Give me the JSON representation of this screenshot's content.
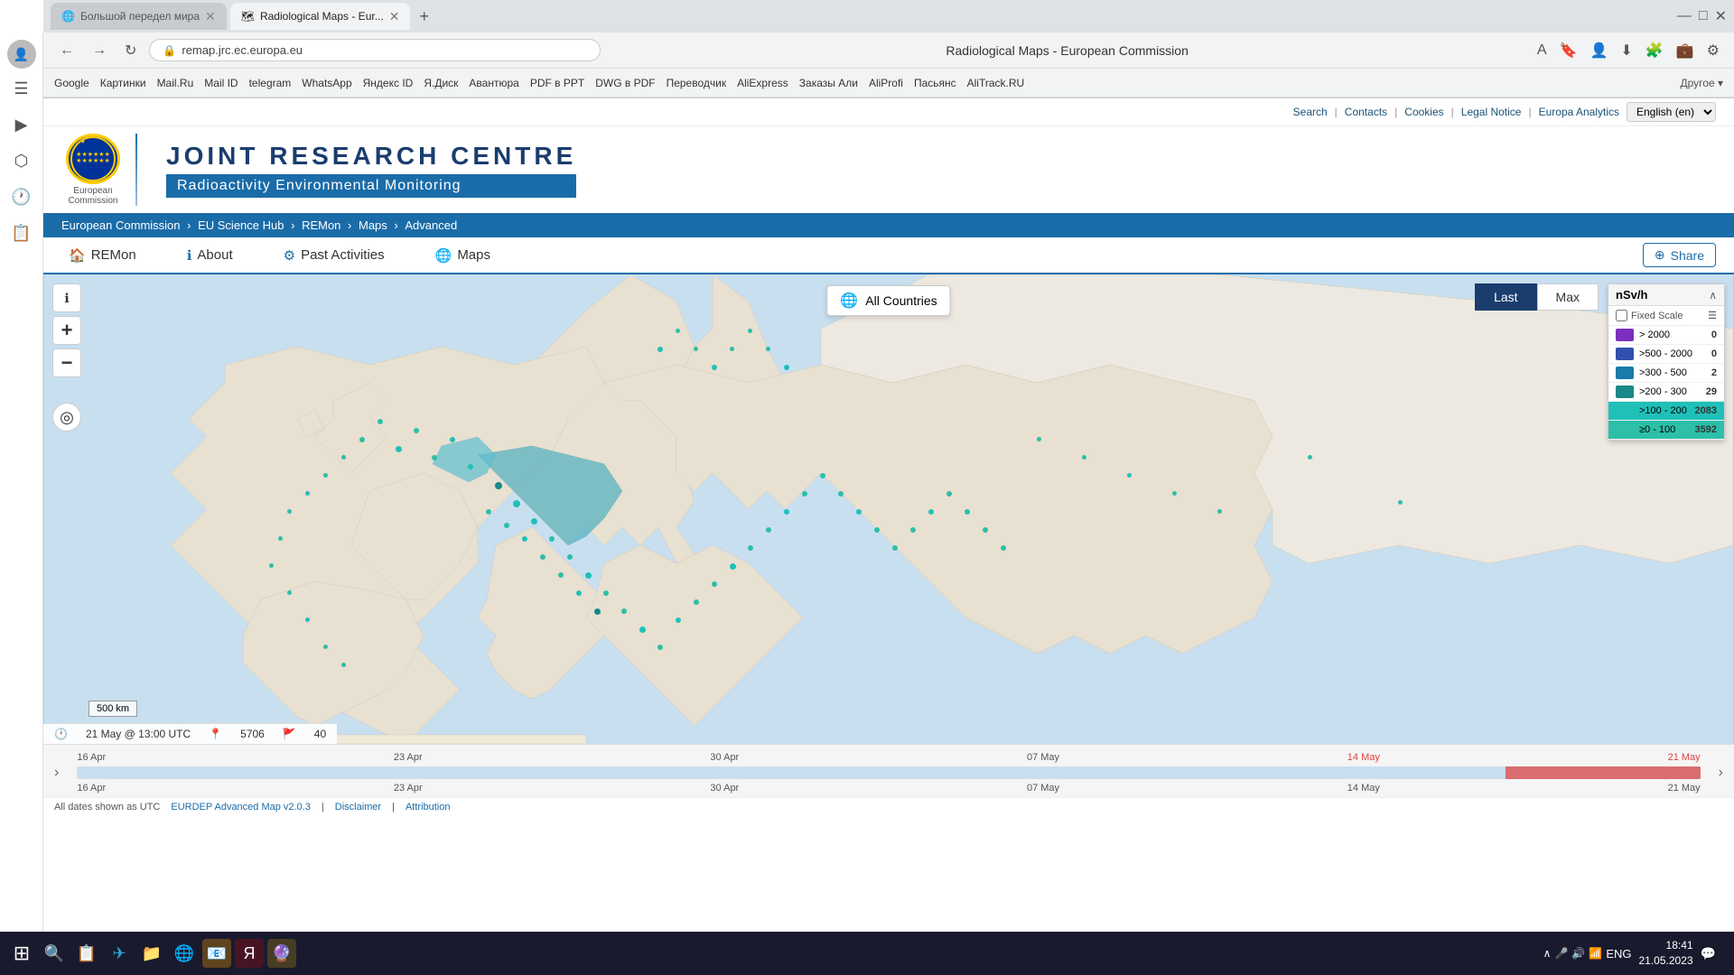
{
  "browser": {
    "tabs": [
      {
        "id": "tab1",
        "title": "Большой передел мира",
        "favicon": "🌐",
        "active": false
      },
      {
        "id": "tab2",
        "title": "Radiological Maps - Eur...",
        "favicon": "🗺",
        "active": true
      }
    ],
    "address": "remap.jrc.ec.europa.eu",
    "page_title": "Radiological Maps - European Commission",
    "bookmarks": [
      "Google",
      "Картинки",
      "Mail.Ru",
      "Mail ID",
      "telegram",
      "WhatsApp",
      "Яндекс ID",
      "Я.Диск",
      "Авантюра",
      "PDF в PPT",
      "DWG в PDF",
      "Переводчик",
      "AliExpress",
      "Заказы Али",
      "AliProfi",
      "Пасьянс",
      "AliTrack.RU"
    ],
    "more_label": "Другое ▾"
  },
  "header_top": {
    "links": [
      "Search",
      "Contacts",
      "Cookies",
      "Legal Notice",
      "Europa Analytics"
    ],
    "lang": "English (en)"
  },
  "site": {
    "jrc_title": "JOINT  RESEARCH  CENTRE",
    "subtitle": "Radioactivity Environmental Monitoring",
    "ec_text1": "European",
    "ec_text2": "Commission"
  },
  "breadcrumb": {
    "items": [
      "European Commission",
      "EU Science Hub",
      "REMon",
      "Maps",
      "Advanced"
    ]
  },
  "nav": {
    "home_label": "REMon",
    "about_label": "About",
    "past_label": "Past Activities",
    "maps_label": "Maps",
    "share_label": "Share"
  },
  "map": {
    "country_selector": "All Countries",
    "scale": "500 km"
  },
  "last_max": {
    "last_label": "Last",
    "max_label": "Max"
  },
  "legend": {
    "unit": "nSv/h",
    "fixed_scale_label": "Fixed Scale",
    "menu_icon": "☰",
    "items": [
      {
        "range": "> 2000",
        "color": "#7b2fbe",
        "count": "0"
      },
      {
        "range": ">500 - 2000",
        "color": "#3050b0",
        "count": "0"
      },
      {
        "range": ">300 - 500",
        "color": "#1a7aaa",
        "count": "2"
      },
      {
        "range": ">200 - 300",
        "color": "#1a8888",
        "count": "29"
      },
      {
        "range": ">100 - 200",
        "color": "#20c0b8",
        "count": "2083"
      },
      {
        "range": "≥0 - 100",
        "color": "#2dbfa8",
        "count": "3592"
      }
    ]
  },
  "status": {
    "date_label": "21 May @ 13:00 UTC",
    "stations": "5706",
    "flags": "40",
    "footer_date": "All dates shown as UTC",
    "map_version": "EURDEP Advanced Map v2.0.3",
    "disclaimer": "Disclaimer",
    "attribution": "Attribution"
  },
  "timeline": {
    "dates": [
      "16 Apr",
      "23 Apr",
      "30 Apr",
      "07 May",
      "14 May",
      "21 May"
    ],
    "highlight_start": "14 May",
    "highlight_end": "21 May"
  },
  "taskbar": {
    "time": "18:41",
    "date": "21.05.2023",
    "lang": "ENG",
    "start_icon": "⊞",
    "icons": [
      "🔍",
      "📋",
      "✈",
      "📁",
      "🌐",
      "📧",
      "🔮",
      "🌀"
    ]
  }
}
